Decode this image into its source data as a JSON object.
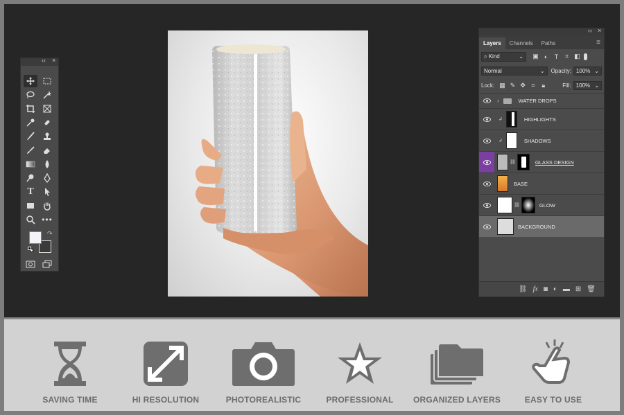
{
  "layers_panel": {
    "tabs": [
      "Layers",
      "Channels",
      "Paths"
    ],
    "active_tab": "Layers",
    "filter_kind": "Kind",
    "blend_mode": "Normal",
    "opacity_label": "Opacity:",
    "opacity_value": "100%",
    "lock_label": "Lock:",
    "fill_label": "Fill:",
    "fill_value": "100%",
    "layers": [
      {
        "name": "WATER DROPS",
        "type": "group"
      },
      {
        "name": "HIGHLIGHTS",
        "type": "clipped"
      },
      {
        "name": "SHADOWS",
        "type": "clipped"
      },
      {
        "name": "GLASS DESIGN",
        "type": "smart-masked",
        "highlighted": true
      },
      {
        "name": "BASE",
        "type": "image"
      },
      {
        "name": "GLOW",
        "type": "masked"
      },
      {
        "name": "BACKGROUND",
        "type": "smart",
        "selected": true
      }
    ]
  },
  "features": [
    {
      "label": "SAVING TIME",
      "icon": "hourglass-icon"
    },
    {
      "label": "HI RESOLUTION",
      "icon": "expand-icon"
    },
    {
      "label": "PHOTOREALISTIC",
      "icon": "camera-icon"
    },
    {
      "label": "PROFESSIONAL",
      "icon": "star-icon"
    },
    {
      "label": "ORGANIZED LAYERS",
      "icon": "folders-icon"
    },
    {
      "label": "EASY TO USE",
      "icon": "tap-hand-icon"
    }
  ],
  "colors": {
    "workspace": "#262626",
    "panel": "#4b4b4b",
    "feature_icon": "#6e6e6e",
    "highlight_purple": "#7b3fa1"
  }
}
